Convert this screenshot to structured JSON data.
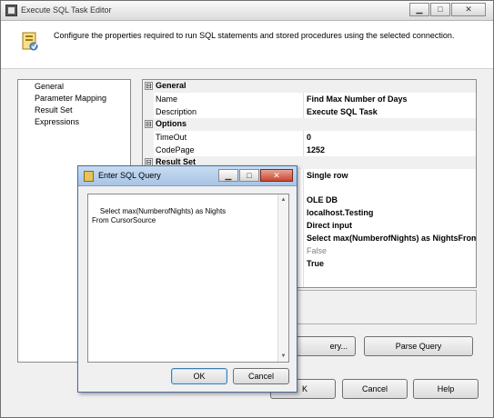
{
  "window": {
    "title": "Execute SQL Task Editor",
    "caption_min": "▁",
    "caption_max": "□",
    "caption_close": "✕"
  },
  "header": {
    "description": "Configure the properties required to run SQL statements and stored procedures using the selected connection."
  },
  "nav": {
    "items": [
      "General",
      "Parameter Mapping",
      "Result Set",
      "Expressions"
    ]
  },
  "properties": {
    "cat_general": "General",
    "cat_options": "Options",
    "cat_result": "Result Set",
    "toggle": "⊟",
    "rows": [
      {
        "name": "Name",
        "value": "Find Max Number of Days"
      },
      {
        "name": "Description",
        "value": "Execute SQL Task"
      },
      {
        "name": "TimeOut",
        "value": "0"
      },
      {
        "name": "CodePage",
        "value": "1252"
      },
      {
        "name": "",
        "value": "Single row"
      },
      {
        "name": "",
        "value": "OLE DB"
      },
      {
        "name": "",
        "value": "localhost.Testing"
      },
      {
        "name": "",
        "value": "Direct input"
      },
      {
        "name": "",
        "value": "Select max(NumberofNights) as NightsFrom Cu"
      },
      {
        "name": "",
        "value": "False"
      },
      {
        "name": "",
        "value": "True"
      }
    ]
  },
  "buttons": {
    "build_query": "ery...",
    "parse_query": "Parse Query",
    "ok": "K",
    "cancel": "Cancel",
    "help": "Help"
  },
  "dialog": {
    "title": "Enter SQL Query",
    "query": "Select max(NumberofNights) as Nights\nFrom CursorSource",
    "ok": "OK",
    "cancel": "Cancel",
    "scroll_up": "▲",
    "scroll_down": "▼"
  }
}
